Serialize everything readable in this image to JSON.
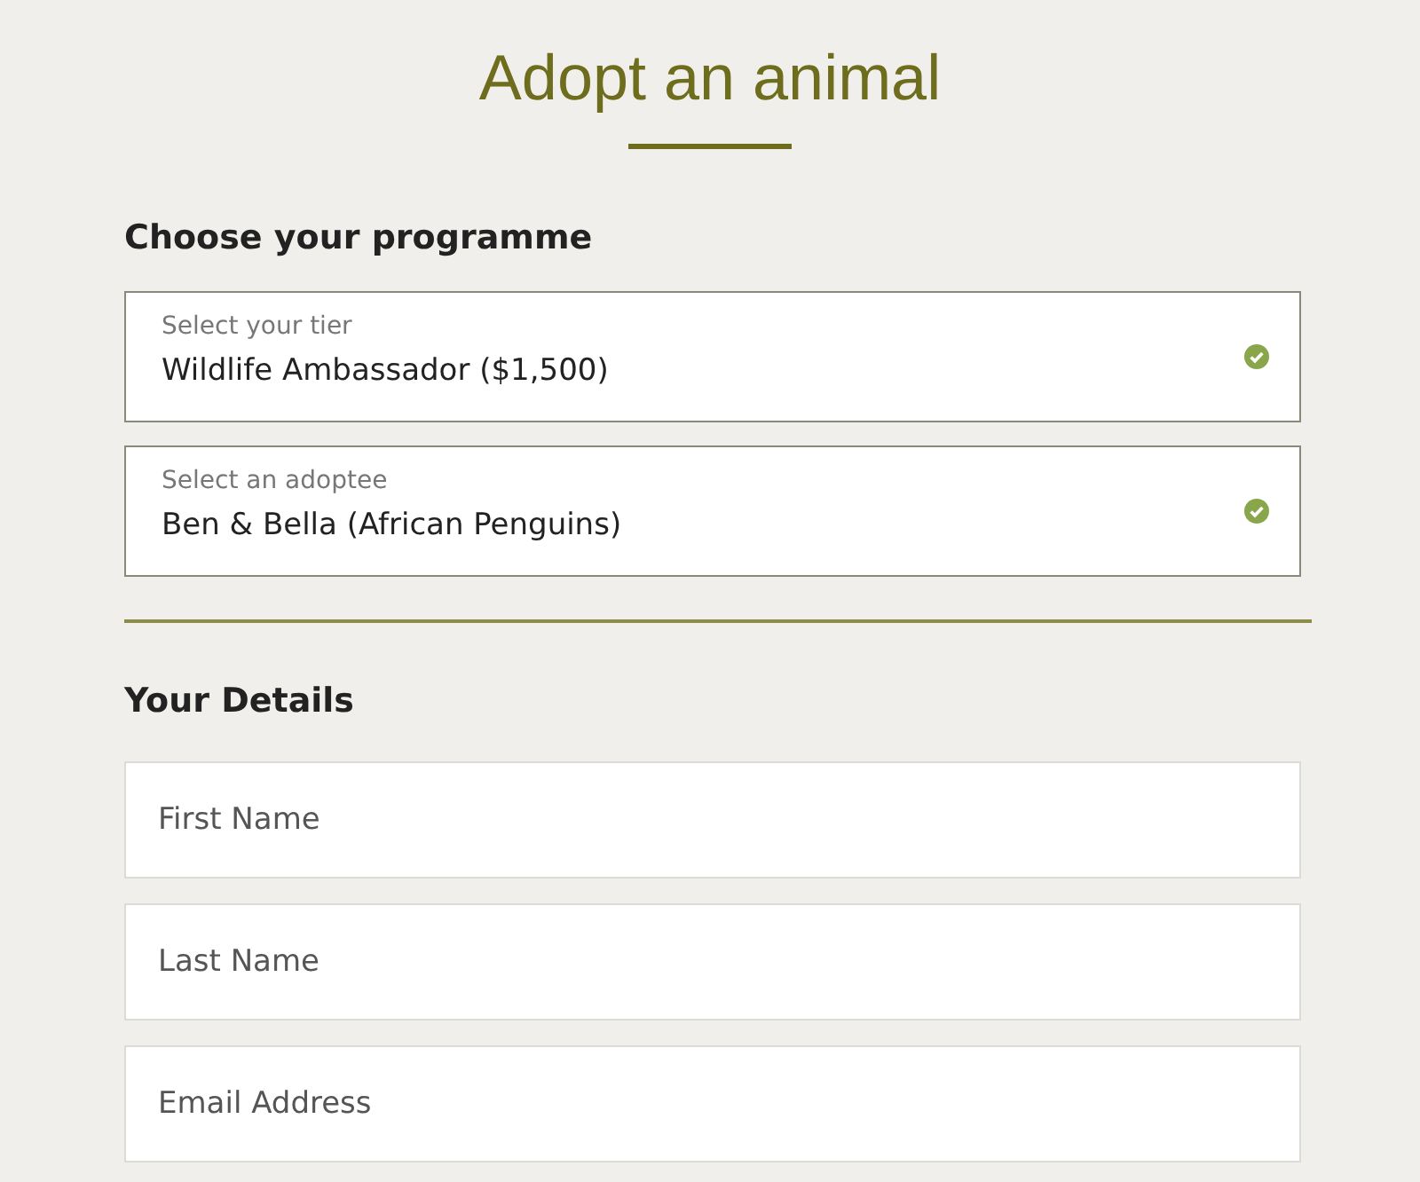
{
  "title": "Adopt an animal",
  "programme": {
    "heading": "Choose your programme",
    "selects": [
      {
        "label": "Select your tier",
        "value": "Wildlife Ambassador ($1,500)",
        "valid": true
      },
      {
        "label": "Select an adoptee",
        "value": "Ben & Bella (African Penguins)",
        "valid": true
      }
    ]
  },
  "details": {
    "heading": "Your Details",
    "fields": [
      {
        "placeholder": "First Name"
      },
      {
        "placeholder": "Last Name"
      },
      {
        "placeholder": "Email Address"
      }
    ]
  }
}
